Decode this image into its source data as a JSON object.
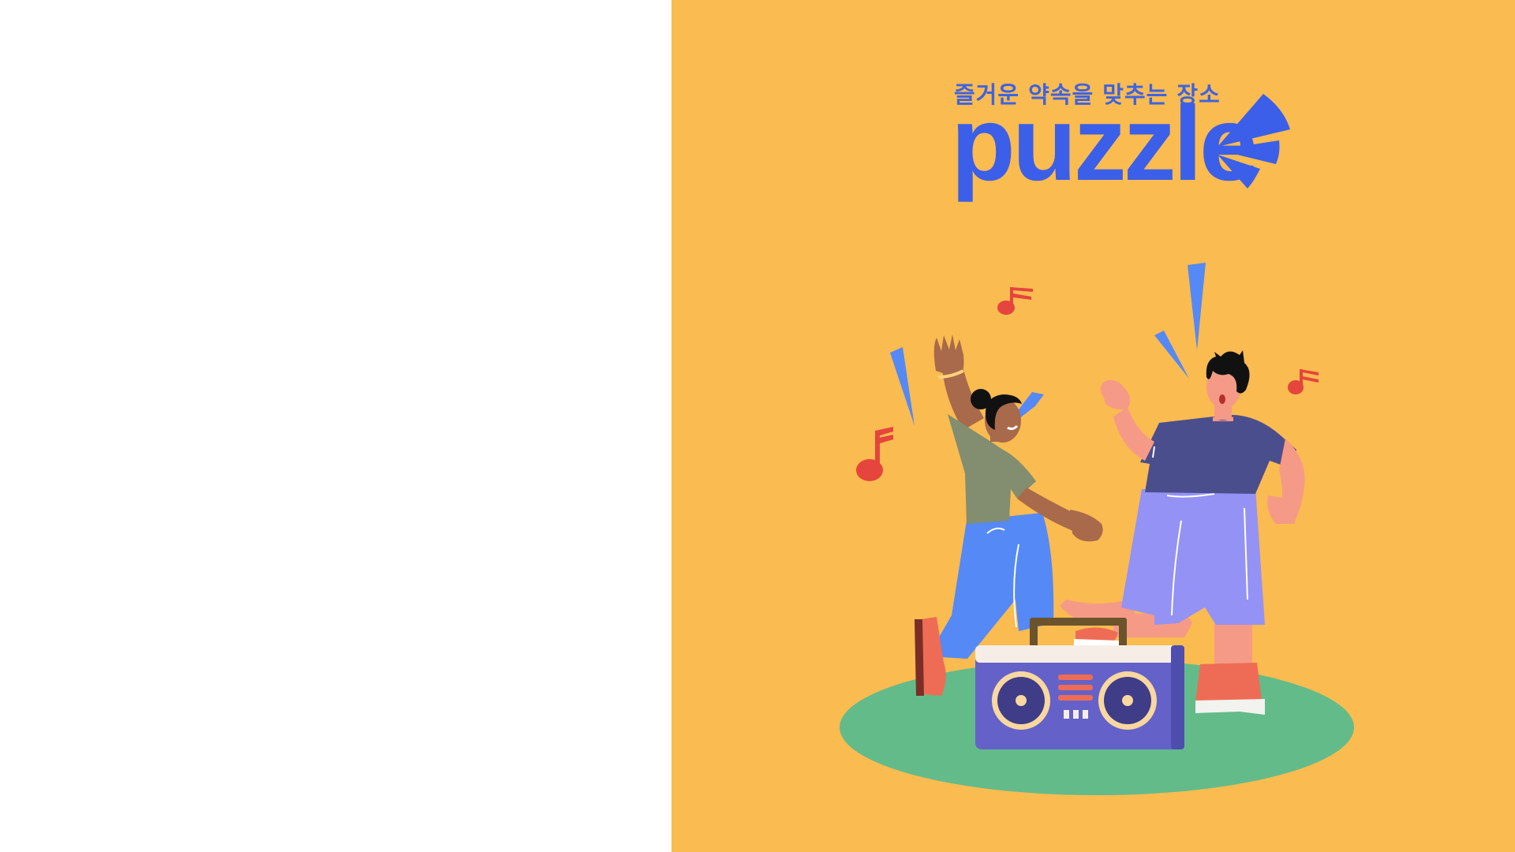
{
  "brand": {
    "tagline": "즐거운 약속을 맞추는 장소",
    "name": "puzzle",
    "logo_icon": "fan-burst-icon"
  },
  "colors": {
    "background_left": "#FFFFFF",
    "background_right": "#FABB50",
    "brand_blue": "#3B5FE8",
    "ground_green": "#63BB8A",
    "note_red": "#E5453C"
  },
  "illustration": {
    "icons": [
      "dancing-woman-icon",
      "dancing-man-icon",
      "boombox-icon",
      "music-note-icon",
      "spark-icon"
    ]
  }
}
